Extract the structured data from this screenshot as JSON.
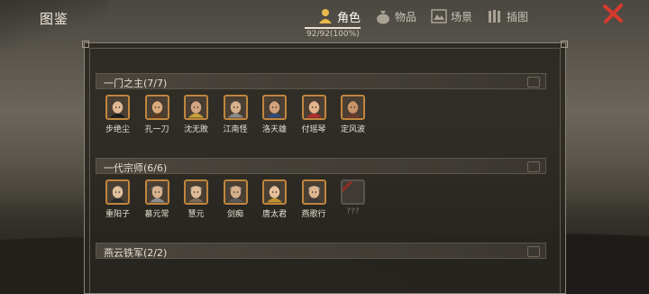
{
  "title": "图鉴",
  "tabs": [
    {
      "label": "角色",
      "icon": "person-icon",
      "active": true
    },
    {
      "label": "物品",
      "icon": "bag-icon",
      "active": false
    },
    {
      "label": "场景",
      "icon": "scene-icon",
      "active": false
    },
    {
      "label": "插图",
      "icon": "illustration-icon",
      "active": false
    }
  ],
  "progress": "92/92(100%)",
  "sections": [
    {
      "title": "一门之主(7/7)",
      "characters": [
        "步绝尘",
        "孔一刀",
        "沈无敗",
        "江南怪",
        "洛天雄",
        "付瑶琴",
        "定风波"
      ]
    },
    {
      "title": "一代宗师(6/6)",
      "characters": [
        "重阳子",
        "慕元常",
        "慧元",
        "剑痴",
        "唐太君",
        "燕歌行",
        "???"
      ]
    },
    {
      "title": "燕云铁军(2/2)",
      "characters": []
    }
  ],
  "colors": {
    "accent": "#c0863d",
    "close": "#d63a2c"
  }
}
